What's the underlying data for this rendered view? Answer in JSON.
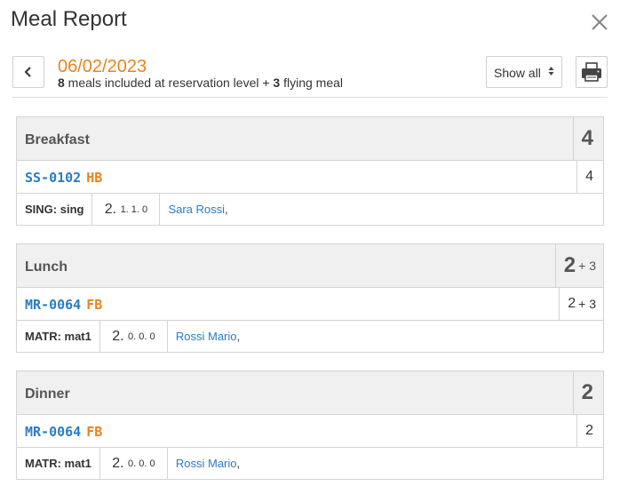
{
  "dialog": {
    "title": "Meal Report",
    "close_icon": "close-icon"
  },
  "toolbar": {
    "date": "06/02/2023",
    "included_count": "8",
    "included_text": " meals included at reservation level + ",
    "flying_count": "3",
    "flying_text": " flying meal",
    "filter": {
      "selected": "Show all",
      "arrows": "up-down-arrows-icon"
    },
    "back_icon": "chevron-left-icon",
    "print_icon": "printer-icon"
  },
  "meals": [
    {
      "name": "Breakfast",
      "count": "4",
      "extra": "",
      "reservation": {
        "code": "SS-0102",
        "plan": "HB",
        "count": "4",
        "extra": ""
      },
      "detail": {
        "room": "SING: sing",
        "pax_main": "2.",
        "pax_sub": "1. 1. 0",
        "guest": "Sara Rossi",
        "separator": " ,"
      }
    },
    {
      "name": "Lunch",
      "count": "2",
      "extra": "+ 3",
      "reservation": {
        "code": "MR-0064",
        "plan": "FB",
        "count": "2",
        "extra": "+ 3"
      },
      "detail": {
        "room": "MATR: mat1",
        "pax_main": "2.",
        "pax_sub": "0. 0. 0",
        "guest": "Rossi Mario",
        "separator": " ,"
      }
    },
    {
      "name": "Dinner",
      "count": "2",
      "extra": "",
      "reservation": {
        "code": "MR-0064",
        "plan": "FB",
        "count": "2",
        "extra": ""
      },
      "detail": {
        "room": "MATR: mat1",
        "pax_main": "2.",
        "pax_sub": "0. 0. 0",
        "guest": "Rossi Mario",
        "separator": " ,"
      }
    }
  ]
}
